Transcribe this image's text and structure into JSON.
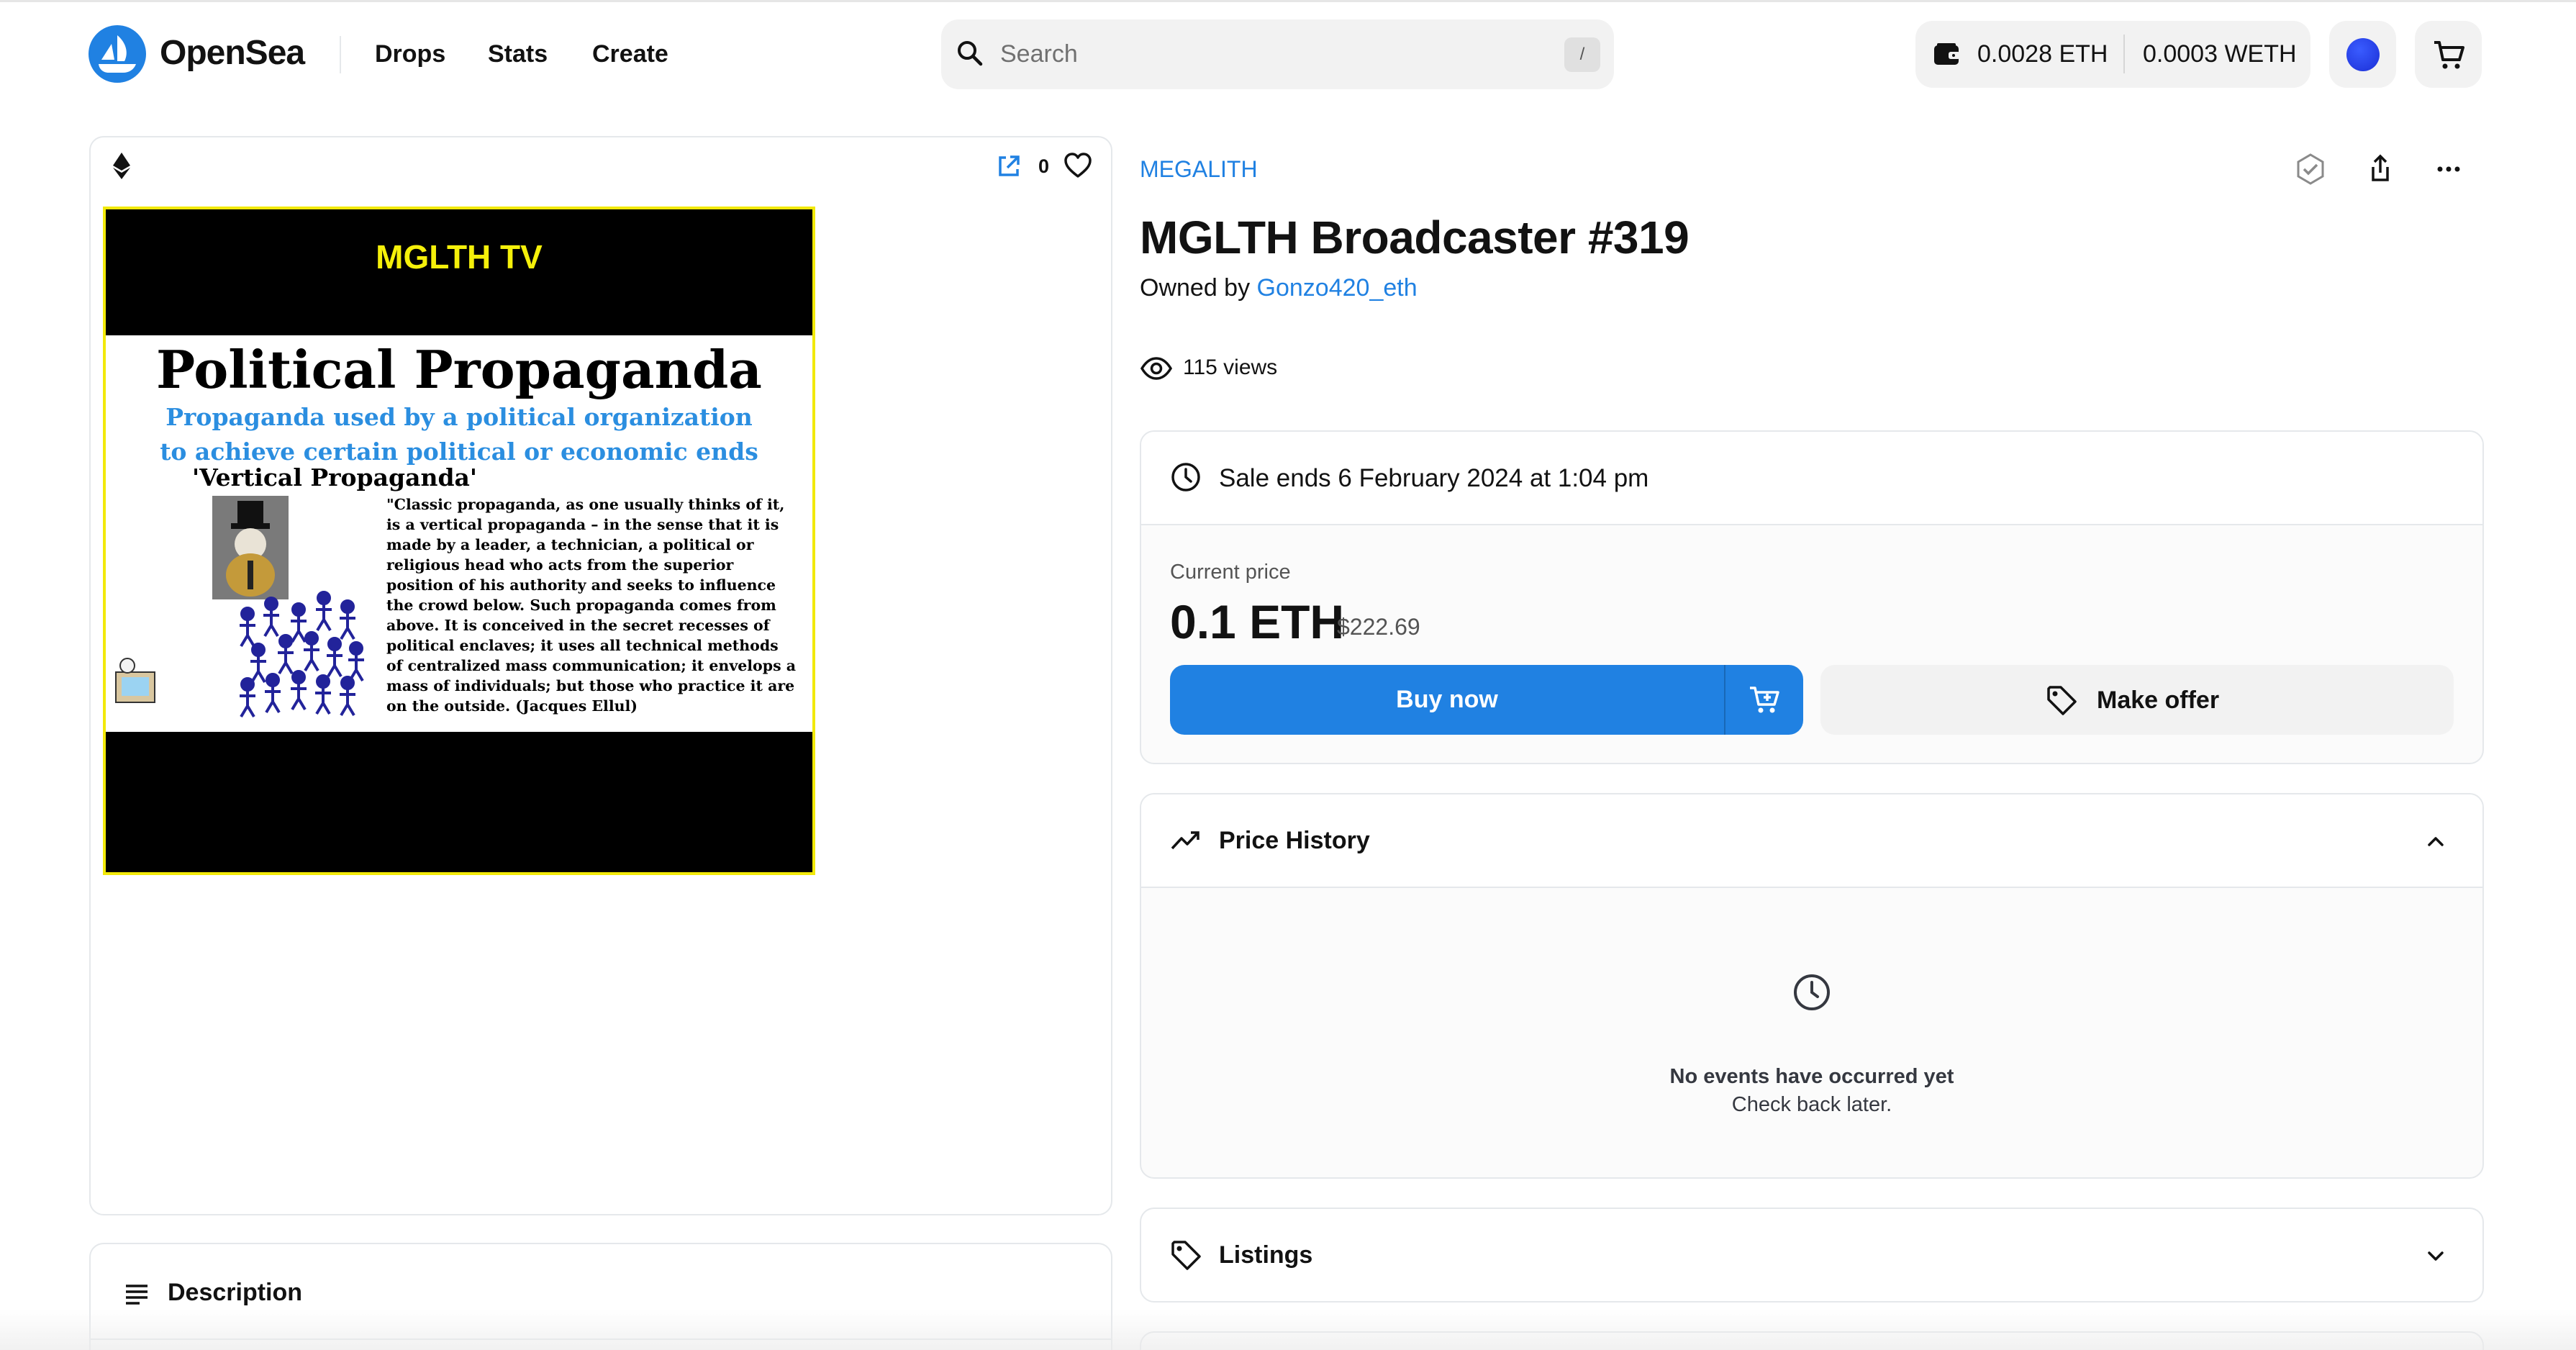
{
  "brand": {
    "name": "OpenSea",
    "accent": "#2081e2"
  },
  "nav": {
    "links": [
      "Drops",
      "Stats",
      "Create"
    ]
  },
  "search": {
    "placeholder": "Search",
    "shortcut": "/"
  },
  "wallet": {
    "eth_balance": "0.0028 ETH",
    "weth_balance": "0.0003 WETH"
  },
  "item": {
    "collection": "MEGALITH",
    "title": "MGLTH Broadcaster #319",
    "owned_by_label": "Owned by",
    "owner": "Gonzo420_eth",
    "views": "115 views",
    "favorites": "0"
  },
  "artwork": {
    "header": "MGLTH TV",
    "heading": "Political Propaganda",
    "subtitle_line1": "Propaganda used by a political organization",
    "subtitle_line2": "to achieve certain political or economic ends",
    "section": "'Vertical Propaganda'",
    "quote_lines": [
      "\"Classic propaganda, as one usually thinks of it,",
      "is a vertical propaganda – in the sense that it is",
      "made by a leader, a technician, a political or",
      "religious head who acts from the superior",
      "position of his authority and seeks to influence",
      "the crowd below. Such propaganda comes from",
      "above. It is conceived in the secret recesses of",
      "political enclaves; it uses all technical methods",
      "of centralized mass communication; it envelops a",
      "mass of individuals; but those who practice it are",
      "on the outside. (Jacques Ellul)"
    ]
  },
  "sale": {
    "ends": "Sale ends 6 February 2024 at 1:04 pm",
    "current_price_label": "Current price",
    "price_eth": "0.1 ETH",
    "price_usd": "$222.69",
    "buy_label": "Buy now",
    "offer_label": "Make offer"
  },
  "price_history": {
    "title": "Price History",
    "empty_title": "No events have occurred yet",
    "empty_sub": "Check back later."
  },
  "listings": {
    "title": "Listings"
  },
  "description": {
    "title": "Description"
  }
}
